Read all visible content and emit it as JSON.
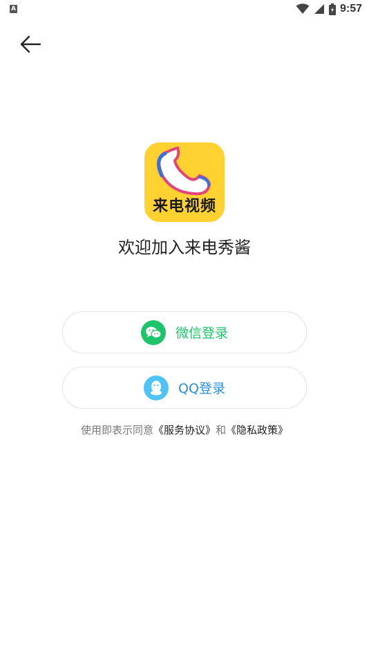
{
  "status_bar": {
    "notification_icon": "A",
    "time": "9:57",
    "icons": [
      "wifi-icon",
      "signal-icon",
      "battery-icon"
    ]
  },
  "header": {
    "back_icon": "arrow-left-icon"
  },
  "logo": {
    "text": "来电视频",
    "background": "#ffd232"
  },
  "welcome": {
    "title": "欢迎加入来电秀酱"
  },
  "login": {
    "wechat_label": "微信登录",
    "qq_label": "QQ登录",
    "wechat_color": "#1ec36a",
    "qq_color": "#2b8fe0"
  },
  "agreement": {
    "prefix": "使用即表示同意",
    "service_link": "《服务协议》",
    "conjunction": "和",
    "privacy_link": "《隐私政策》"
  }
}
